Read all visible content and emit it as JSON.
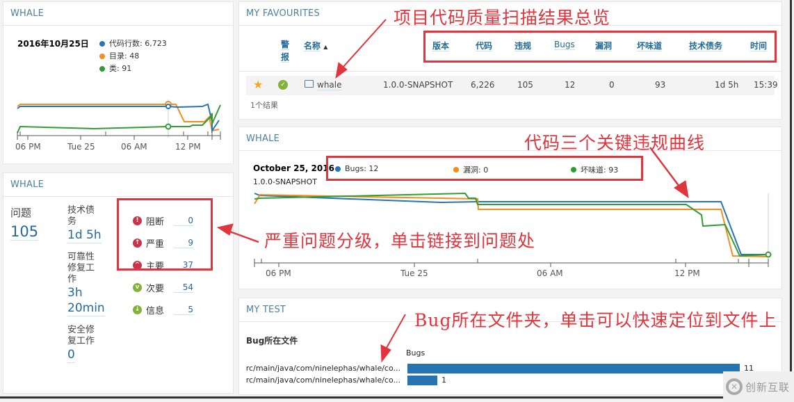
{
  "colors": {
    "blue": "#2674b2",
    "orange": "#f58c1e",
    "green": "#2f9d33",
    "accent_text": "#236a97",
    "annotation_red": "#e0353d"
  },
  "size_widget": {
    "title": "WHALE",
    "date": "2016年10月25日",
    "legend": [
      {
        "label": "代码行数: 6,723",
        "color": "#2674b2"
      },
      {
        "label": "目录: 48",
        "color": "#f58c1e"
      },
      {
        "label": "类: 91",
        "color": "#2f9d33"
      }
    ],
    "axis_labels": [
      "06 PM",
      "Tue 25",
      "06 AM",
      "12 PM"
    ]
  },
  "issues_widget": {
    "title": "WHALE",
    "issues_label": "问题",
    "issues_value": "105",
    "debt": [
      {
        "label": "技术债务",
        "value": "1d 5h"
      },
      {
        "label": "可靠性修复工作",
        "value": "3h 20min"
      },
      {
        "label": "安全修复工作",
        "value": "0"
      }
    ],
    "severities": [
      {
        "label": "阻断",
        "count": "0",
        "icon": "blocker-icon",
        "glyph": "!"
      },
      {
        "label": "严重",
        "count": "9",
        "icon": "critical-icon",
        "glyph": "↑"
      },
      {
        "label": "主要",
        "count": "37",
        "icon": "major-icon",
        "glyph": "^"
      },
      {
        "label": "次要",
        "count": "54",
        "icon": "minor-icon",
        "glyph": "v"
      },
      {
        "label": "信息",
        "count": "5",
        "icon": "info-icon",
        "glyph": "↓"
      }
    ]
  },
  "favourites": {
    "title": "MY FAVOURITES",
    "headers": {
      "alert": "警报",
      "name": "名称",
      "sort_icon": "▲",
      "version": "版本",
      "loc": "代码",
      "violations": "违规",
      "bugs": "Bugs",
      "vulnerabilities": "漏洞",
      "code_smells": "坏味道",
      "debt": "技术债务",
      "time": "时间"
    },
    "rows": [
      {
        "name": "whale",
        "version": "1.0.0-SNAPSHOT",
        "loc": "6,226",
        "violations": "105",
        "bugs": "12",
        "vulnerabilities": "0",
        "code_smells": "93",
        "debt": "1d 5h",
        "time": "15:39"
      }
    ],
    "result_count": "1个结果"
  },
  "main_chart": {
    "title": "WHALE",
    "date": "October 25, 2016",
    "version": "1.0.0-SNAPSHOT",
    "legend": [
      {
        "label": "Bugs: 12",
        "color": "#2674b2"
      },
      {
        "label": "漏洞: 0",
        "color": "#f58c1e"
      },
      {
        "label": "坏味道: 93",
        "color": "#2f9d33"
      }
    ],
    "axis_labels": [
      "06 PM",
      "Tue 25",
      "06 AM",
      "12 PM"
    ]
  },
  "my_test": {
    "title": "MY TEST",
    "subtitle": "Bug所在文件",
    "column_label": "Bugs",
    "rows": [
      {
        "path": "rc/main/java/com/ninelephas/whale/co...",
        "value": 11
      },
      {
        "path": "rc/main/java/com/ninelephas/whale/co...",
        "value": 1
      }
    ],
    "max": 11
  },
  "annotations": {
    "favourites": "项目代码质量扫描结果总览",
    "chart": "代码三个关键违规曲线",
    "severity": "严重问题分级，单击链接到问题处",
    "files": "Bug所在文件夹，单击可以快速定位到文件上"
  },
  "watermark": {
    "text": "创新互联"
  }
}
